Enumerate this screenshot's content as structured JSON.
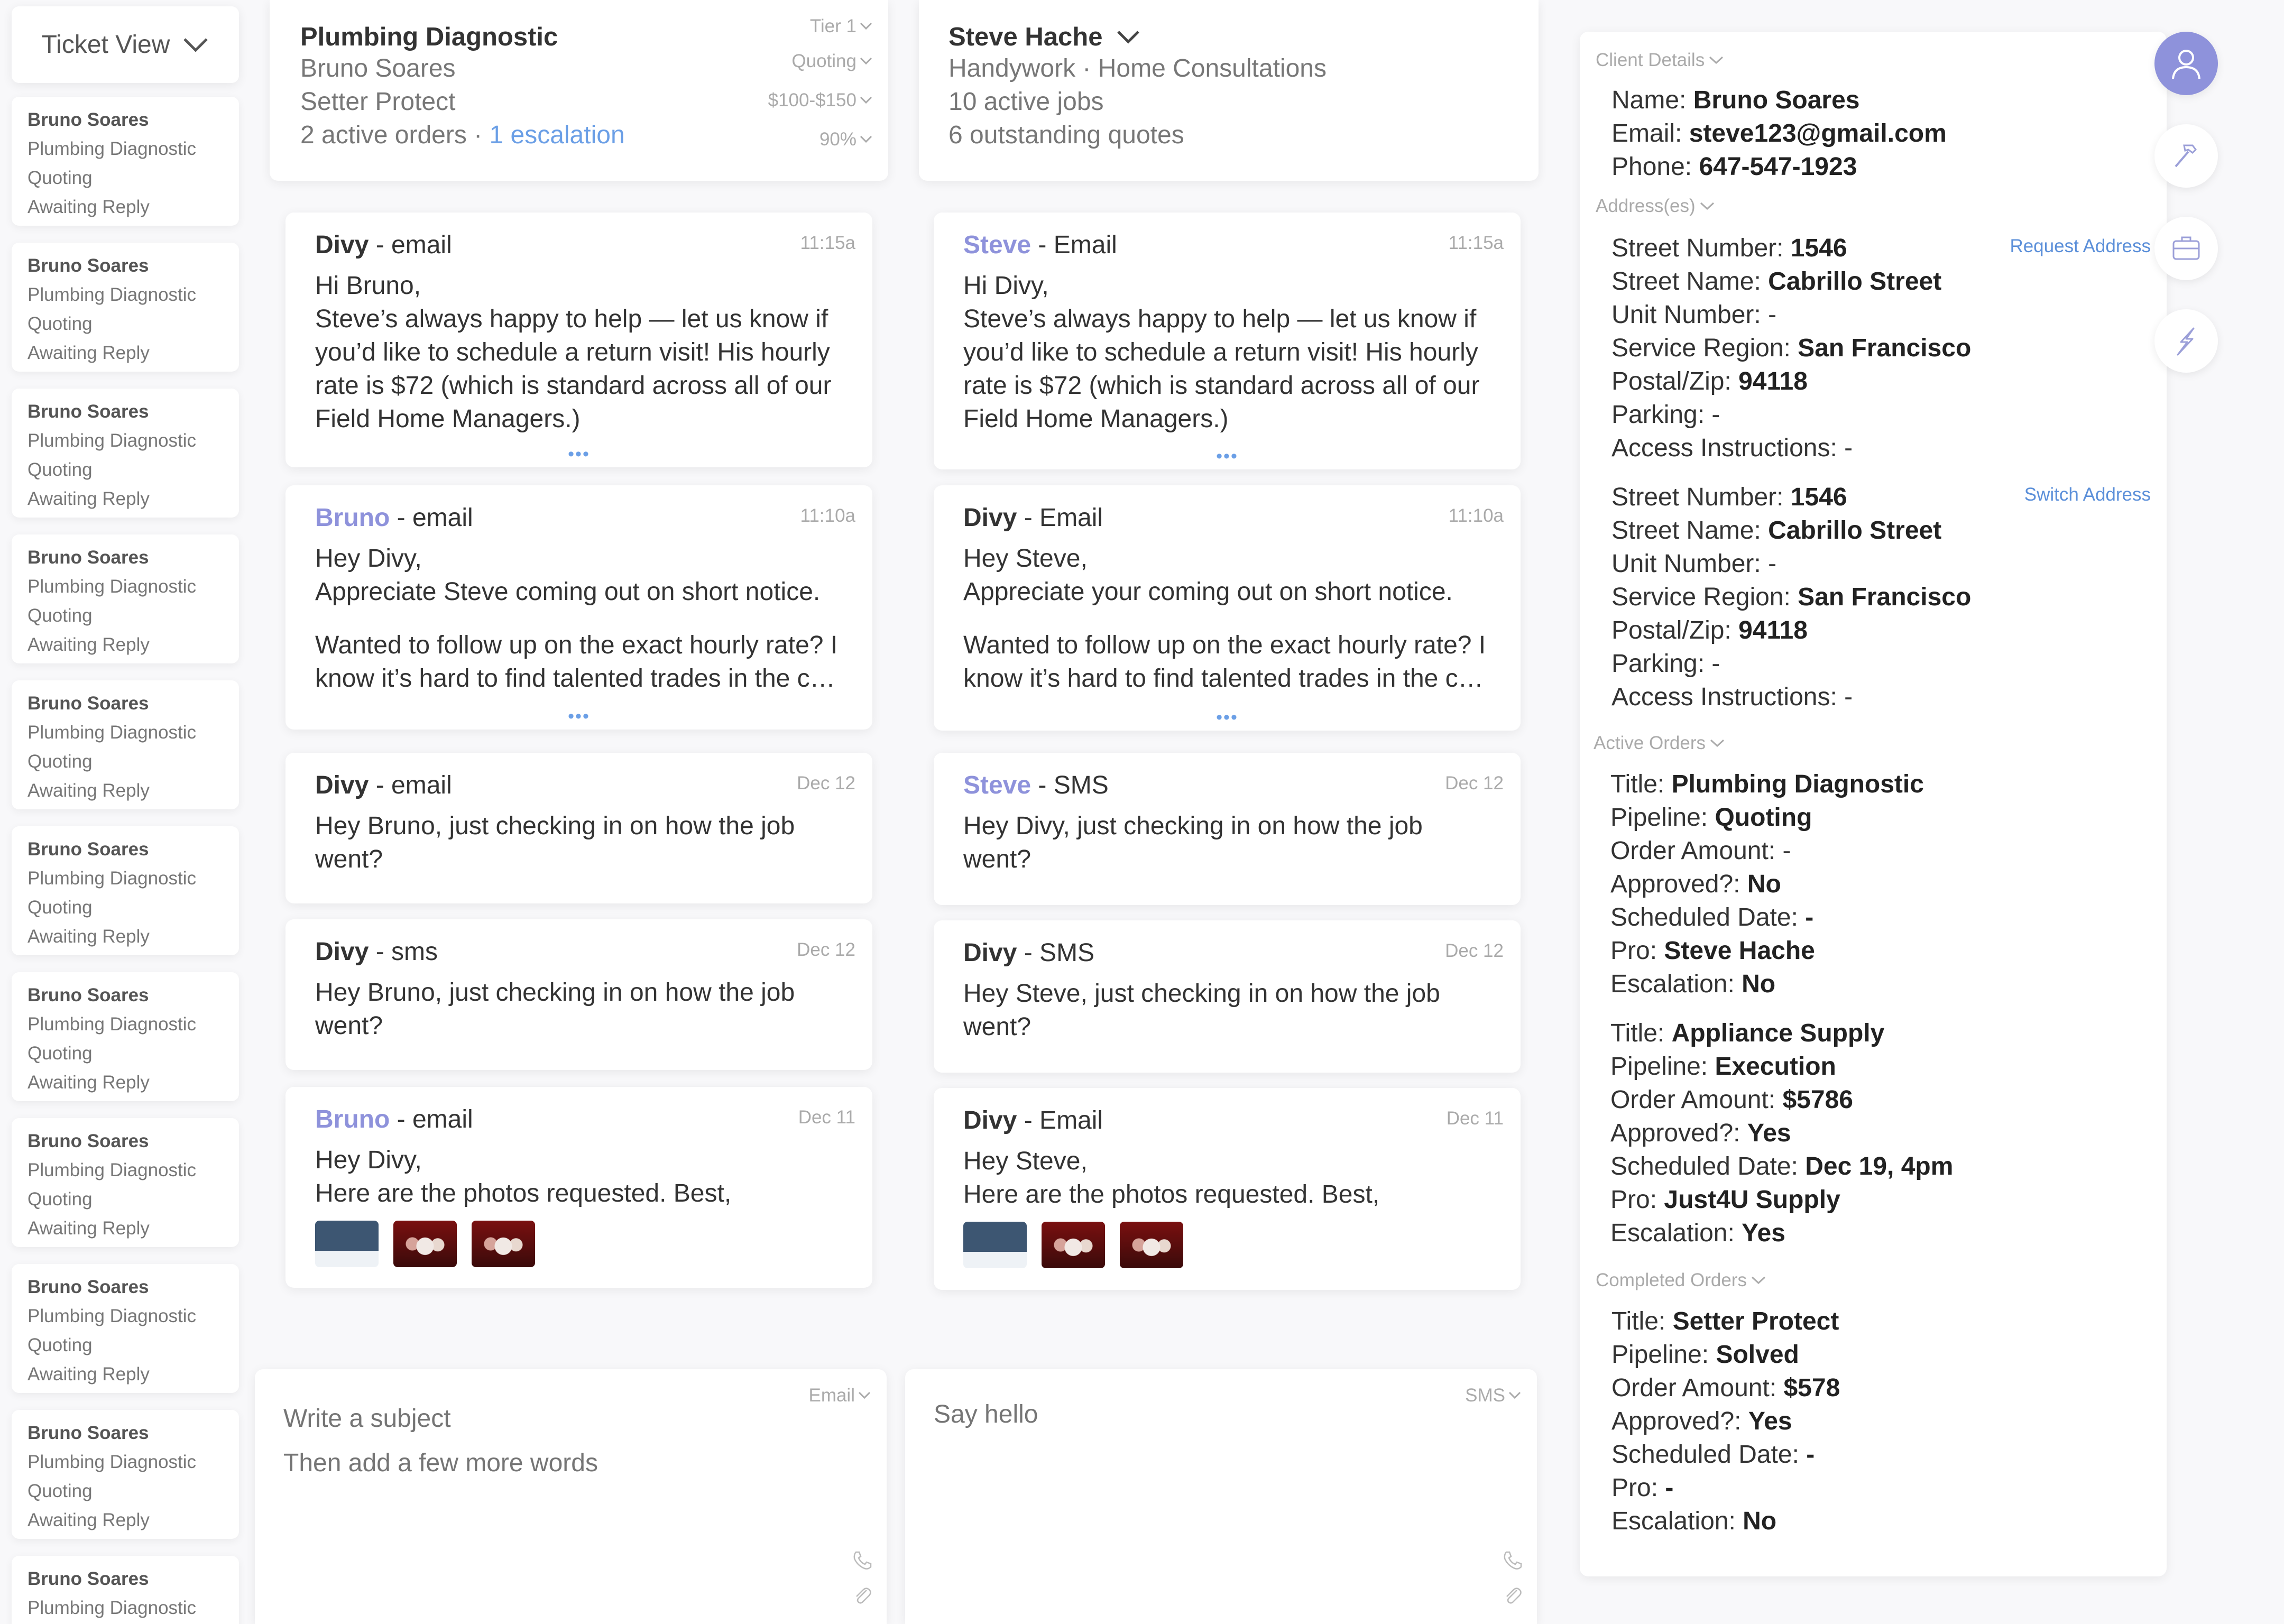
{
  "sidebar": {
    "view_label": "Ticket View",
    "tickets": [
      {
        "name": "Bruno Soares",
        "title": "Plumbing Diagnostic",
        "stage": "Quoting",
        "status": "Awaiting Reply"
      },
      {
        "name": "Bruno Soares",
        "title": "Plumbing Diagnostic",
        "stage": "Quoting",
        "status": "Awaiting Reply"
      },
      {
        "name": "Bruno Soares",
        "title": "Plumbing Diagnostic",
        "stage": "Quoting",
        "status": "Awaiting Reply"
      },
      {
        "name": "Bruno Soares",
        "title": "Plumbing Diagnostic",
        "stage": "Quoting",
        "status": "Awaiting Reply"
      },
      {
        "name": "Bruno Soares",
        "title": "Plumbing Diagnostic",
        "stage": "Quoting",
        "status": "Awaiting Reply"
      },
      {
        "name": "Bruno Soares",
        "title": "Plumbing Diagnostic",
        "stage": "Quoting",
        "status": "Awaiting Reply"
      },
      {
        "name": "Bruno Soares",
        "title": "Plumbing Diagnostic",
        "stage": "Quoting",
        "status": "Awaiting Reply"
      },
      {
        "name": "Bruno Soares",
        "title": "Plumbing Diagnostic",
        "stage": "Quoting",
        "status": "Awaiting Reply"
      },
      {
        "name": "Bruno Soares",
        "title": "Plumbing Diagnostic",
        "stage": "Quoting",
        "status": "Awaiting Reply"
      },
      {
        "name": "Bruno Soares",
        "title": "Plumbing Diagnostic",
        "stage": "Quoting",
        "status": "Awaiting Reply"
      },
      {
        "name": "Bruno Soares",
        "title": "Plumbing Diagnostic"
      }
    ]
  },
  "client_summary": {
    "title": "Plumbing Diagnostic",
    "client": "Bruno Soares",
    "company": "Setter Protect",
    "orders_text": "2 active orders · ",
    "escalation_text": "1 escalation",
    "tier": "Tier 1",
    "pipeline": "Quoting",
    "budget": "$100-$150",
    "percent": "90%"
  },
  "pro_summary": {
    "name": "Steve Hache",
    "services": "Handywork · Home Consultations",
    "jobs": "10 active jobs",
    "quotes": "6 outstanding quotes"
  },
  "client_thread": [
    {
      "sender": "Divy",
      "channel": " - email",
      "time": "11:15a",
      "lines": [
        "Hi Bruno,",
        "Steve’s always happy to help — let us know if you’d like to schedule a return visit! His hourly rate is $72 (which is standard across all of our Field Home Managers.)"
      ],
      "more": "•••"
    },
    {
      "sender": "Bruno",
      "channel": " - email",
      "time": "11:10a",
      "lines": [
        "Hey Divy,",
        "Appreciate Steve coming out on short notice."
      ],
      "para2": "Wanted to follow up on the exact hourly rate? I know it’s hard to find talented trades in the c…",
      "more": "•••"
    },
    {
      "sender": "Divy",
      "channel": " - email",
      "time": "Dec 12",
      "lines": [
        "Hey Bruno, just checking in on how the job went?"
      ]
    },
    {
      "sender": "Divy",
      "channel": " - sms",
      "time": "Dec 12",
      "lines": [
        "Hey Bruno, just checking in on how the job went?"
      ]
    },
    {
      "sender": "Bruno",
      "channel": " - email",
      "time": "Dec 11",
      "lines": [
        "Hey Divy,",
        "Here are the photos requested. Best,"
      ]
    }
  ],
  "pro_thread": [
    {
      "sender": "Steve",
      "channel": " - Email",
      "time": "11:15a",
      "lines": [
        "Hi Divy,",
        "Steve’s always happy to help — let us know if you’d like to schedule a return visit! His hourly rate is $72 (which is standard across all of our Field Home Managers.)"
      ],
      "more": "•••"
    },
    {
      "sender": "Divy",
      "channel": " - Email",
      "time": "11:10a",
      "lines": [
        "Hey Steve,",
        "Appreciate your coming out on short notice."
      ],
      "para2": "Wanted to follow up on the exact hourly rate? I know it’s hard to find talented trades in the c…",
      "more": "•••"
    },
    {
      "sender": "Steve",
      "channel": " - SMS",
      "time": "Dec 12",
      "lines": [
        "Hey Divy, just checking in on how the job went?"
      ]
    },
    {
      "sender": "Divy",
      "channel": " - SMS",
      "time": "Dec 12",
      "lines": [
        "Hey Steve, just checking in on how the job went?"
      ]
    },
    {
      "sender": "Divy",
      "channel": " - Email",
      "time": "Dec 11",
      "lines": [
        "Hey Steve,",
        "Here are the photos requested. Best,"
      ]
    }
  ],
  "compose_client": {
    "channel": "Email",
    "subject_placeholder": "Write a subject",
    "body_placeholder": "Then add a few more words"
  },
  "compose_pro": {
    "channel": "SMS",
    "body_placeholder": "Say hello"
  },
  "details": {
    "client_details_label": "Client Details",
    "name_label": "Name: ",
    "name": "Bruno Soares",
    "email_label": "Email: ",
    "email": "steve123@gmail.com",
    "phone_label": "Phone: ",
    "phone": "647-547-1923",
    "addresses_label": "Address(es)",
    "request_address": "Request Address",
    "switch_address": "Switch Address",
    "addresses": [
      {
        "street_number": "1546",
        "street_name": "Cabrillo Street",
        "unit": "-",
        "region": "San Francisco",
        "postal": "94118",
        "parking": "-",
        "access": "-"
      },
      {
        "street_number": "1546",
        "street_name": "Cabrillo Street",
        "unit": "-",
        "region": "San Francisco",
        "postal": "94118",
        "parking": "-",
        "access": "-"
      }
    ],
    "address_labels": {
      "street_number": "Street Number: ",
      "street_name": "Street Name: ",
      "unit": "Unit Number: ",
      "region": "Service Region: ",
      "postal": "Postal/Zip: ",
      "parking": "Parking: ",
      "access": "Access Instructions: "
    },
    "active_orders_label": "Active Orders",
    "completed_orders_label": "Completed Orders",
    "order_labels": {
      "title": "Title: ",
      "pipeline": "Pipeline: ",
      "amount": "Order Amount: ",
      "approved": "Approved?: ",
      "scheduled": "Scheduled Date: ",
      "pro": "Pro: ",
      "escalation": "Escalation: "
    },
    "active_orders": [
      {
        "title": "Plumbing Diagnostic",
        "pipeline": "Quoting",
        "amount": "-",
        "approved": "No",
        "scheduled": "-",
        "pro": "Steve Hache",
        "escalation": "No"
      },
      {
        "title": "Appliance Supply",
        "pipeline": "Execution",
        "amount": "$5786",
        "approved": "Yes",
        "scheduled": "Dec 19, 4pm",
        "pro": "Just4U Supply",
        "escalation": "Yes"
      }
    ],
    "completed_orders": [
      {
        "title": "Setter Protect",
        "pipeline": "Solved",
        "amount": "$578",
        "approved": "Yes",
        "scheduled": "-",
        "pro": "-",
        "escalation": "No"
      }
    ]
  },
  "rail": {
    "icons": [
      "user-icon",
      "hammer-icon",
      "briefcase-icon",
      "lightning-icon"
    ]
  },
  "colors": {
    "accent": "#8e92db",
    "link": "#6b9fe6",
    "background": "#f8f8fa"
  }
}
